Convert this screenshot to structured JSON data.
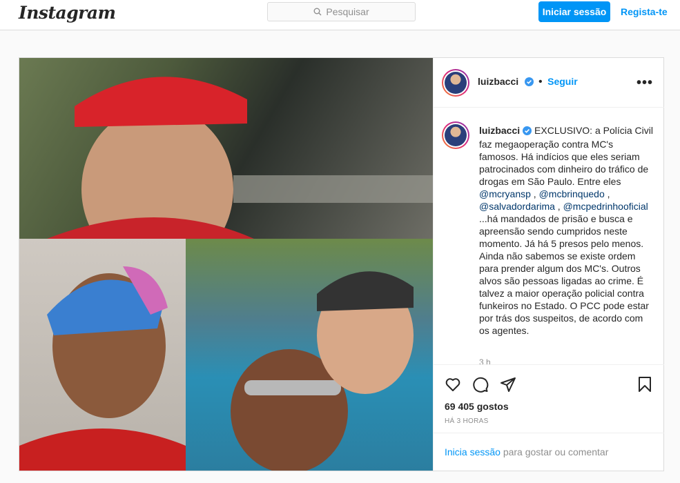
{
  "nav": {
    "logo": "Instagram",
    "search_placeholder": "Pesquisar",
    "login_label": "Iniciar sessão",
    "signup_label": "Regista-te"
  },
  "post": {
    "username": "luizbacci",
    "follow_label": "Seguir",
    "caption_text_1": "EXCLUSIVO: a Polícia Civil faz megaoperação contra MC's famosos. Há indícios que eles seriam patrocinados com dinheiro do tráfico de drogas em São Paulo. Entre eles",
    "mention_1": "@mcryansp",
    "mention_2": "@mcbrinquedo",
    "mention_3": "@salvadordarima",
    "mention_4": "@mcpedrinhooficial",
    "caption_text_2": "...há mandados de prisão e busca e apreensão sendo cumpridos neste momento. Já há 5 presos pelo menos. Ainda não sabemos se existe ordem para prender algum dos MC's. Outros alvos são pessoas ligadas ao crime. É talvez a maior operação policial contra funkeiros no Estado. O PCC pode estar por trás dos suspeitos, de acordo com os agentes.",
    "comment_time": "3 h",
    "likes": "69 405 gostos",
    "posted_ago": "HÁ 3 HORAS",
    "login_link": "Inicia sessão",
    "login_suffix": " para gostar ou comentar"
  },
  "icons": [
    "search-icon",
    "verified-icon",
    "more-icon",
    "heart-icon",
    "comment-icon",
    "share-icon",
    "bookmark-icon"
  ],
  "colors": {
    "accent": "#0095f6",
    "link": "#00376b",
    "muted": "#8e8e8e",
    "border": "#dbdbdb"
  }
}
